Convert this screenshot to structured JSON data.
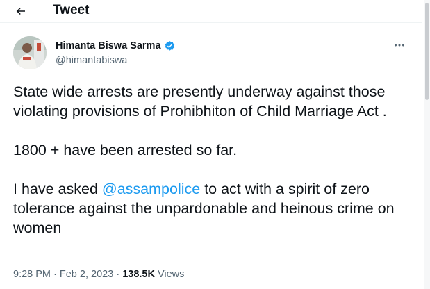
{
  "header": {
    "title": "Tweet",
    "back_icon": "arrow-left-icon"
  },
  "author": {
    "name": "Himanta Biswa Sarma",
    "handle": "@himantabiswa",
    "verified_icon": "verified-badge-icon",
    "verified_color": "#1d9bf0"
  },
  "tweet": {
    "paragraph1": "State wide arrests are presently underway against those violating provisions of Prohibhiton of Child Marriage Act .",
    "paragraph2": "1800 + have been arrested so far.",
    "paragraph3_before": "I have asked ",
    "mention": "@assampolice",
    "paragraph3_after": " to act with a spirit of zero tolerance against the unpardonable and heinous crime on women"
  },
  "meta": {
    "time": "9:28 PM",
    "separator": " · ",
    "date": "Feb 2, 2023",
    "views_count": "138.5K",
    "views_label": " Views"
  },
  "colors": {
    "accent": "#1d9bf0",
    "text": "#0f1419",
    "secondary": "#536471"
  }
}
